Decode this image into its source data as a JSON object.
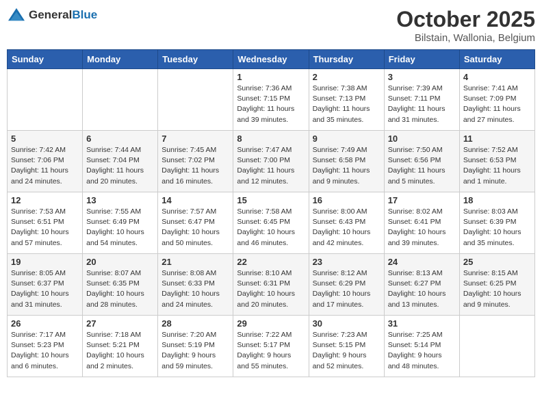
{
  "header": {
    "logo_general": "General",
    "logo_blue": "Blue",
    "month": "October 2025",
    "location": "Bilstain, Wallonia, Belgium"
  },
  "weekdays": [
    "Sunday",
    "Monday",
    "Tuesday",
    "Wednesday",
    "Thursday",
    "Friday",
    "Saturday"
  ],
  "weeks": [
    [
      {
        "day": "",
        "info": ""
      },
      {
        "day": "",
        "info": ""
      },
      {
        "day": "",
        "info": ""
      },
      {
        "day": "1",
        "info": "Sunrise: 7:36 AM\nSunset: 7:15 PM\nDaylight: 11 hours\nand 39 minutes."
      },
      {
        "day": "2",
        "info": "Sunrise: 7:38 AM\nSunset: 7:13 PM\nDaylight: 11 hours\nand 35 minutes."
      },
      {
        "day": "3",
        "info": "Sunrise: 7:39 AM\nSunset: 7:11 PM\nDaylight: 11 hours\nand 31 minutes."
      },
      {
        "day": "4",
        "info": "Sunrise: 7:41 AM\nSunset: 7:09 PM\nDaylight: 11 hours\nand 27 minutes."
      }
    ],
    [
      {
        "day": "5",
        "info": "Sunrise: 7:42 AM\nSunset: 7:06 PM\nDaylight: 11 hours\nand 24 minutes."
      },
      {
        "day": "6",
        "info": "Sunrise: 7:44 AM\nSunset: 7:04 PM\nDaylight: 11 hours\nand 20 minutes."
      },
      {
        "day": "7",
        "info": "Sunrise: 7:45 AM\nSunset: 7:02 PM\nDaylight: 11 hours\nand 16 minutes."
      },
      {
        "day": "8",
        "info": "Sunrise: 7:47 AM\nSunset: 7:00 PM\nDaylight: 11 hours\nand 12 minutes."
      },
      {
        "day": "9",
        "info": "Sunrise: 7:49 AM\nSunset: 6:58 PM\nDaylight: 11 hours\nand 9 minutes."
      },
      {
        "day": "10",
        "info": "Sunrise: 7:50 AM\nSunset: 6:56 PM\nDaylight: 11 hours\nand 5 minutes."
      },
      {
        "day": "11",
        "info": "Sunrise: 7:52 AM\nSunset: 6:53 PM\nDaylight: 11 hours\nand 1 minute."
      }
    ],
    [
      {
        "day": "12",
        "info": "Sunrise: 7:53 AM\nSunset: 6:51 PM\nDaylight: 10 hours\nand 57 minutes."
      },
      {
        "day": "13",
        "info": "Sunrise: 7:55 AM\nSunset: 6:49 PM\nDaylight: 10 hours\nand 54 minutes."
      },
      {
        "day": "14",
        "info": "Sunrise: 7:57 AM\nSunset: 6:47 PM\nDaylight: 10 hours\nand 50 minutes."
      },
      {
        "day": "15",
        "info": "Sunrise: 7:58 AM\nSunset: 6:45 PM\nDaylight: 10 hours\nand 46 minutes."
      },
      {
        "day": "16",
        "info": "Sunrise: 8:00 AM\nSunset: 6:43 PM\nDaylight: 10 hours\nand 42 minutes."
      },
      {
        "day": "17",
        "info": "Sunrise: 8:02 AM\nSunset: 6:41 PM\nDaylight: 10 hours\nand 39 minutes."
      },
      {
        "day": "18",
        "info": "Sunrise: 8:03 AM\nSunset: 6:39 PM\nDaylight: 10 hours\nand 35 minutes."
      }
    ],
    [
      {
        "day": "19",
        "info": "Sunrise: 8:05 AM\nSunset: 6:37 PM\nDaylight: 10 hours\nand 31 minutes."
      },
      {
        "day": "20",
        "info": "Sunrise: 8:07 AM\nSunset: 6:35 PM\nDaylight: 10 hours\nand 28 minutes."
      },
      {
        "day": "21",
        "info": "Sunrise: 8:08 AM\nSunset: 6:33 PM\nDaylight: 10 hours\nand 24 minutes."
      },
      {
        "day": "22",
        "info": "Sunrise: 8:10 AM\nSunset: 6:31 PM\nDaylight: 10 hours\nand 20 minutes."
      },
      {
        "day": "23",
        "info": "Sunrise: 8:12 AM\nSunset: 6:29 PM\nDaylight: 10 hours\nand 17 minutes."
      },
      {
        "day": "24",
        "info": "Sunrise: 8:13 AM\nSunset: 6:27 PM\nDaylight: 10 hours\nand 13 minutes."
      },
      {
        "day": "25",
        "info": "Sunrise: 8:15 AM\nSunset: 6:25 PM\nDaylight: 10 hours\nand 9 minutes."
      }
    ],
    [
      {
        "day": "26",
        "info": "Sunrise: 7:17 AM\nSunset: 5:23 PM\nDaylight: 10 hours\nand 6 minutes."
      },
      {
        "day": "27",
        "info": "Sunrise: 7:18 AM\nSunset: 5:21 PM\nDaylight: 10 hours\nand 2 minutes."
      },
      {
        "day": "28",
        "info": "Sunrise: 7:20 AM\nSunset: 5:19 PM\nDaylight: 9 hours\nand 59 minutes."
      },
      {
        "day": "29",
        "info": "Sunrise: 7:22 AM\nSunset: 5:17 PM\nDaylight: 9 hours\nand 55 minutes."
      },
      {
        "day": "30",
        "info": "Sunrise: 7:23 AM\nSunset: 5:15 PM\nDaylight: 9 hours\nand 52 minutes."
      },
      {
        "day": "31",
        "info": "Sunrise: 7:25 AM\nSunset: 5:14 PM\nDaylight: 9 hours\nand 48 minutes."
      },
      {
        "day": "",
        "info": ""
      }
    ]
  ]
}
